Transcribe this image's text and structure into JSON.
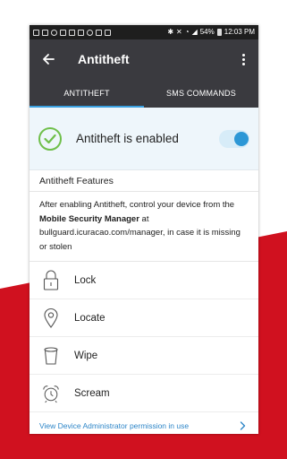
{
  "colors": {
    "accent": "#2c97d6",
    "brand_red": "#d0111f",
    "appbar": "#3a3a3f",
    "success": "#6fbf4a"
  },
  "statusbar": {
    "battery": "54%",
    "time": "12:03 PM"
  },
  "appbar": {
    "title": "Antitheft",
    "back_icon": "arrow-left-icon",
    "more_icon": "more-vertical-icon"
  },
  "tabs": [
    {
      "label": "ANTITHEFT",
      "active": true
    },
    {
      "label": "SMS COMMANDS",
      "active": false
    }
  ],
  "status": {
    "text": "Antitheft is enabled",
    "enabled": true
  },
  "features_header": "Antitheft Features",
  "description": {
    "before": "After enabling Antitheft, control your device from the ",
    "bold": "Mobile Security Manager",
    "after": " at bullguard.icuracao.com/manager, in case it is missing or stolen"
  },
  "features": [
    {
      "label": "Lock",
      "icon": "padlock-icon"
    },
    {
      "label": "Locate",
      "icon": "map-pin-icon"
    },
    {
      "label": "Wipe",
      "icon": "trash-icon"
    },
    {
      "label": "Scream",
      "icon": "alarm-clock-icon"
    }
  ],
  "footer_link": "View Device Administrator permission in use"
}
